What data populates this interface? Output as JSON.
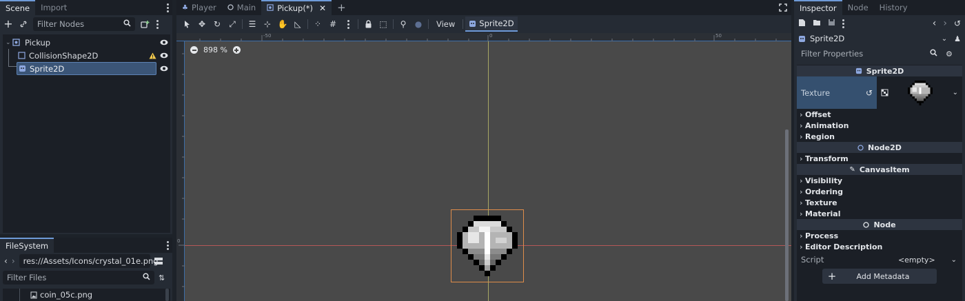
{
  "scene_dock": {
    "tabs": [
      "Scene",
      "Import"
    ],
    "filter_placeholder": "Filter Nodes",
    "nodes": [
      {
        "name": "Pickup",
        "icon": "node2d-icon"
      },
      {
        "name": "CollisionShape2D",
        "icon": "collision-shape-icon"
      },
      {
        "name": "Sprite2D",
        "icon": "sprite2d-icon"
      }
    ]
  },
  "filesystem_dock": {
    "tab": "FileSystem",
    "path": "res://Assets/Icons/crystal_01e.png",
    "filter_placeholder": "Filter Files",
    "files": [
      "coin_05c.png"
    ]
  },
  "editor_tabs": [
    "Player",
    "Main",
    "Pickup(*)"
  ],
  "toolbar": {
    "view_label": "View",
    "selected_node": "Sprite2D"
  },
  "viewport": {
    "zoom_label": "898 %",
    "ruler_labels": [
      "-50",
      "0",
      "50"
    ],
    "ruler_v_label": "0"
  },
  "inspector": {
    "tabs": [
      "Inspector",
      "Node",
      "History"
    ],
    "object_name": "Sprite2D",
    "filter_placeholder": "Filter Properties",
    "class_sprite": "Sprite2D",
    "texture_label": "Texture",
    "sprite_sections": [
      "Offset",
      "Animation",
      "Region"
    ],
    "class_node2d": "Node2D",
    "node2d_sections": [
      "Transform"
    ],
    "class_canvasitem": "CanvasItem",
    "canvas_sections": [
      "Visibility",
      "Ordering",
      "Texture",
      "Material"
    ],
    "class_node": "Node",
    "node_sections": [
      "Process",
      "Editor Description"
    ],
    "script_label": "Script",
    "script_value": "<empty>",
    "add_metadata_label": "Add Metadata"
  },
  "colors": {
    "accent": "#6e9ad8",
    "warning": "#f2c94c",
    "selection": "#3b5577"
  }
}
